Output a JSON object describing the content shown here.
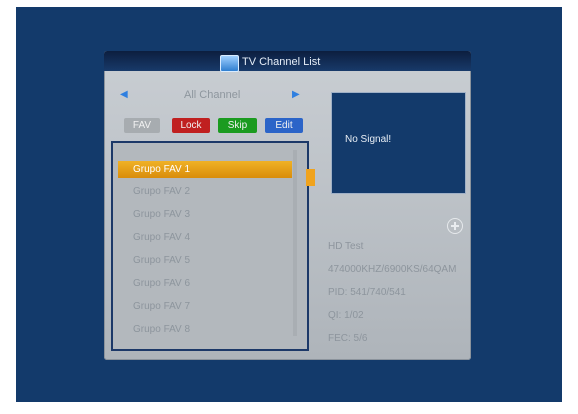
{
  "window": {
    "title": "TV Channel List"
  },
  "nav": {
    "label": "All Channel",
    "left_icon": "left-arrow-icon",
    "right_icon": "right-arrow-icon"
  },
  "tabs": [
    {
      "label": "FAV",
      "color": "#a7acb0"
    },
    {
      "label": "Lock",
      "color": "#c02020"
    },
    {
      "label": "Skip",
      "color": "#1b9b20"
    },
    {
      "label": "Edit",
      "color": "#2b64c8"
    }
  ],
  "list": {
    "items": [
      "Grupo FAV 1",
      "Grupo FAV 2",
      "Grupo FAV 3",
      "Grupo FAV 4",
      "Grupo FAV 5",
      "Grupo FAV 6",
      "Grupo FAV 7",
      "Grupo FAV 8"
    ],
    "selected_index": 0
  },
  "preview": {
    "message": "No Signal!"
  },
  "info": {
    "channel": "HD Test",
    "frequency": "474000KHZ/6900KS/64QAM",
    "pid": "PID: 541/740/541",
    "qi": "QI: 1/02",
    "fec": "FEC: 5/6"
  },
  "colors": {
    "background": "#133a6b",
    "panel": "#bcc2c7",
    "selection": "#e59a12"
  }
}
